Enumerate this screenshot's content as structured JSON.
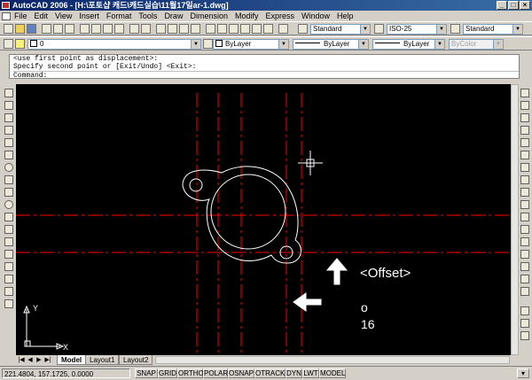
{
  "window": {
    "title": "AutoCAD 2006 - [H:\\̃̄ ̂̃3 ̅̂̎̊̌̆̋11̆̋17̅̀ar-1.dwg]",
    "title_display": "AutoCAD 2006 - [H:\\포토샵 캐드\\캐드실습\\11월17일ar-1.dwg]"
  },
  "menu": [
    "File",
    "Edit",
    "View",
    "Insert",
    "Format",
    "Tools",
    "Draw",
    "Dimension",
    "Modify",
    "Express",
    "Window",
    "Help"
  ],
  "styles_toolbar": {
    "text_style": "Standard",
    "dim_style": "ISO-25",
    "table_style": "Standard"
  },
  "layers_toolbar": {
    "layer": "0"
  },
  "properties_toolbar": {
    "color": "ByLayer",
    "linetype": "ByLayer",
    "lineweight": "ByLayer",
    "plotstyle": "ByColor"
  },
  "command": {
    "history": [
      "<use first point as displacement>:",
      "Specify second point or [Exit/Undo] <Exit>:"
    ],
    "prompt": "Command:"
  },
  "annotations": {
    "offset_label": "<Offset>",
    "typed_key": "o",
    "typed_value": "16"
  },
  "ucs": {
    "x": "X",
    "y": "Y"
  },
  "tabs": [
    {
      "label": "Model",
      "active": true
    },
    {
      "label": "Layout1",
      "active": false
    },
    {
      "label": "Layout2",
      "active": false
    }
  ],
  "status": {
    "coords": "221.4804, 157.1725, 0.0000",
    "buttons": [
      "SNAP",
      "GRID",
      "ORTHO",
      "POLAR",
      "OSNAP",
      "OTRACK",
      "DYN",
      "LWT",
      "MODEL"
    ]
  },
  "colors": {
    "canvas": "#000000",
    "geometry": "#ffffff",
    "center_lines": "#ff0000",
    "crosshair": "#ffffff"
  }
}
